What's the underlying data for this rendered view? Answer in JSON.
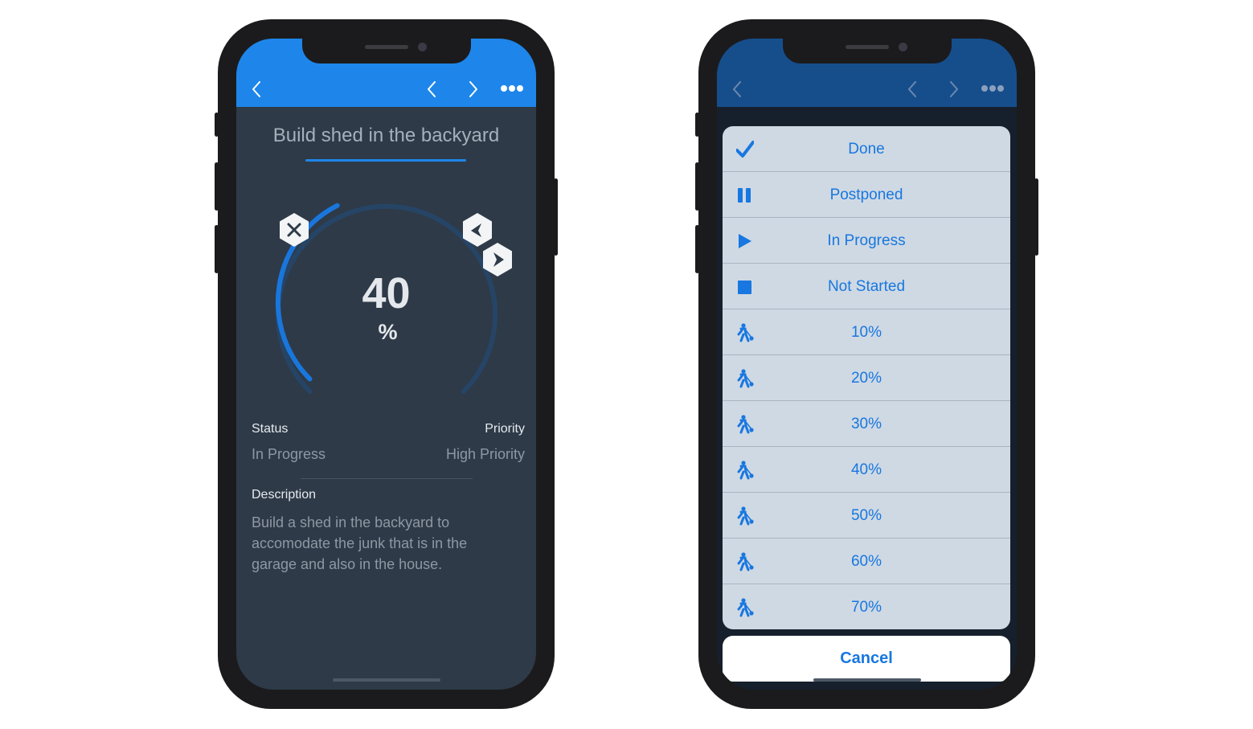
{
  "colors": {
    "accent": "#1e86ea",
    "accent_dark": "#164e8c",
    "screen_bg": "#2e3a48",
    "sheet_bg": "#cfd9e3",
    "action_text": "#1877e0"
  },
  "left_screen": {
    "nav": {
      "back_icon": "chevron-left-icon",
      "prev_icon": "chevron-left-icon",
      "next_icon": "chevron-right-icon",
      "more_icon": "more-dots-icon"
    },
    "task": {
      "title": "Build shed in the backyard",
      "progress_value": "40",
      "progress_unit": "%",
      "progress_fraction": 0.4,
      "status_label": "Status",
      "status_value": "In Progress",
      "priority_label": "Priority",
      "priority_value": "High Priority",
      "description_label": "Description",
      "description_text": "Build a shed in the backyard to accomodate the junk that is in the garage and also in the house."
    }
  },
  "right_screen": {
    "status_options": [
      {
        "label": "Done",
        "icon": "checkmark-icon"
      },
      {
        "label": "Postponed",
        "icon": "pause-icon"
      },
      {
        "label": "In Progress",
        "icon": "play-icon"
      },
      {
        "label": "Not Started",
        "icon": "stop-icon"
      },
      {
        "label": "10%",
        "icon": "worker-icon"
      },
      {
        "label": "20%",
        "icon": "worker-icon"
      },
      {
        "label": "30%",
        "icon": "worker-icon"
      },
      {
        "label": "40%",
        "icon": "worker-icon"
      },
      {
        "label": "50%",
        "icon": "worker-icon"
      },
      {
        "label": "60%",
        "icon": "worker-icon"
      },
      {
        "label": "70%",
        "icon": "worker-icon"
      }
    ],
    "cancel_label": "Cancel"
  }
}
